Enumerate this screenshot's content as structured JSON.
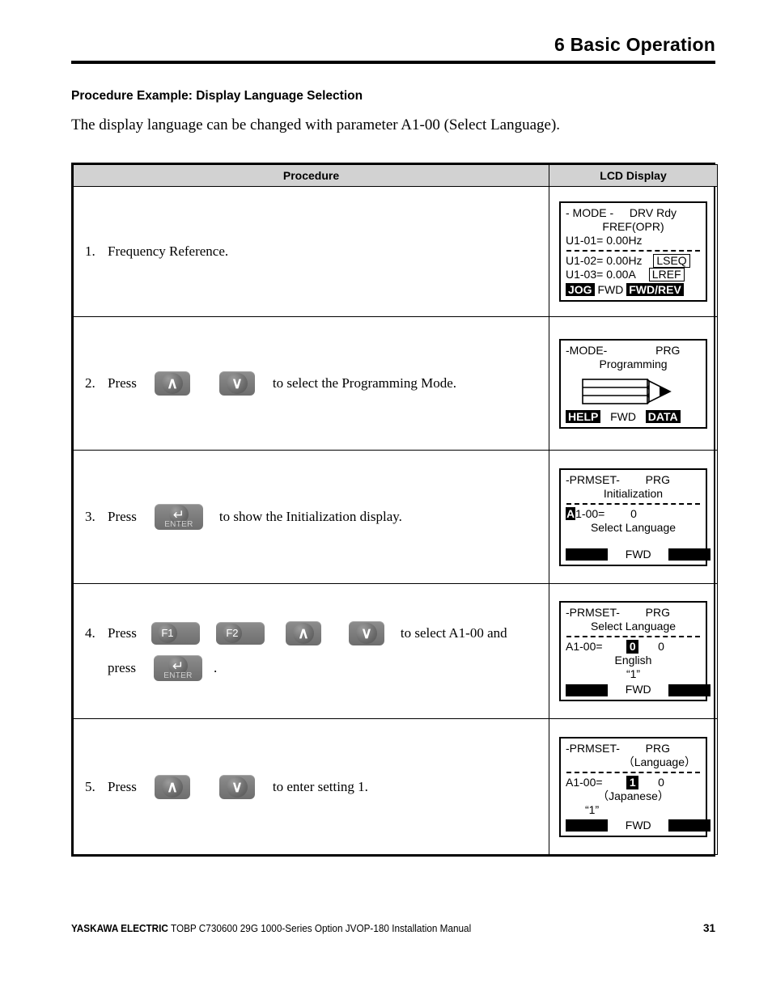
{
  "header": {
    "chapter": "6  Basic Operation"
  },
  "intro": {
    "heading": "Procedure Example: Display Language Selection",
    "paragraph": "The display language can be changed with parameter A1-00 (Select Language)."
  },
  "table": {
    "columns": [
      "Procedure",
      "LCD Display"
    ],
    "rows": [
      {
        "num": "1.",
        "text_before": "Frequency Reference.",
        "buttons": [],
        "text_after": "",
        "lcd": {
          "line1_left": "- MODE -",
          "line1_right": "DRV  Rdy",
          "line2": "FREF(OPR)",
          "line3": "U1-01= 0.00Hz",
          "divider": true,
          "line4_left": "U1-02=  0.00Hz",
          "line4_box": "LSEQ",
          "line5_left": "U1-03=  0.00A",
          "line5_box": "LREF",
          "bottom": {
            "left_label": "JOG",
            "left_inverted": true,
            "center": "FWD",
            "right_label": "FWD/REV",
            "right_inverted": true
          }
        }
      },
      {
        "num": "2.",
        "text_before": "Press",
        "buttons": [
          "up",
          "down"
        ],
        "text_after": "to select the Programming Mode.",
        "lcd": {
          "line1_left": "-MODE-",
          "line1_right": "PRG",
          "line2": "Programming",
          "graphic": "pencil-icon",
          "bottom": {
            "left_label": "HELP",
            "left_inverted": true,
            "center": "FWD",
            "right_label": "DATA",
            "right_inverted": true
          }
        }
      },
      {
        "num": "3.",
        "text_before": "Press",
        "buttons": [
          "enter"
        ],
        "text_after": "to show the Initialization display.",
        "lcd": {
          "line1_left": "-PRMSET-",
          "line1_right": "PRG",
          "line2": "Initialization",
          "divider": true,
          "param_inv": "A",
          "param_rest": "1-00=",
          "param_value": "0",
          "line_desc": "Select Language",
          "bottom": {
            "left_label": "",
            "left_inverted": true,
            "center": "FWD",
            "right_label": "",
            "right_inverted": true
          }
        }
      },
      {
        "num": "4.",
        "text_before": "Press",
        "buttons": [
          "f1",
          "f2",
          "up",
          "down"
        ],
        "text_after": "to select A1-00 and",
        "line2_before": "press",
        "line2_buttons": [
          "enter"
        ],
        "line2_after": ".",
        "lcd": {
          "line1_left": "-PRMSET-",
          "line1_right": "PRG",
          "line2": "Select  Language",
          "divider": true,
          "param_rest": "A1-00=",
          "param_sel": "0",
          "param_value": "0",
          "line_desc": "English",
          "line_quote": "“1”",
          "bottom": {
            "left_label": "",
            "left_inverted": true,
            "center": "FWD",
            "right_label": "",
            "right_inverted": true
          }
        }
      },
      {
        "num": "5.",
        "text_before": "Press",
        "buttons": [
          "up",
          "down"
        ],
        "text_after": "to enter setting 1.",
        "lcd": {
          "line1_left": "-PRMSET-",
          "line1_right": "PRG",
          "line2": "（Language）",
          "divider": true,
          "param_rest": "A1-00=",
          "param_sel": "1",
          "param_value": "0",
          "line_desc": "（Japanese）",
          "line_quote": "“1”",
          "bottom": {
            "left_label": "",
            "left_inverted": true,
            "center": "FWD",
            "right_label": "",
            "right_inverted": true
          }
        }
      }
    ]
  },
  "buttons": {
    "up": {
      "glyph": "∧",
      "label": ""
    },
    "down": {
      "glyph": "∨",
      "label": ""
    },
    "f1": {
      "glyph": "F1",
      "label": ""
    },
    "f2": {
      "glyph": "F2",
      "label": ""
    },
    "enter": {
      "glyph": "↵",
      "label": "ENTER"
    }
  },
  "footer": {
    "brand": "YASKAWA ELECTRIC",
    "doc": "TOBP C730600 29G 1000-Series Option JVOP-180 Installation Manual",
    "page": "31"
  }
}
